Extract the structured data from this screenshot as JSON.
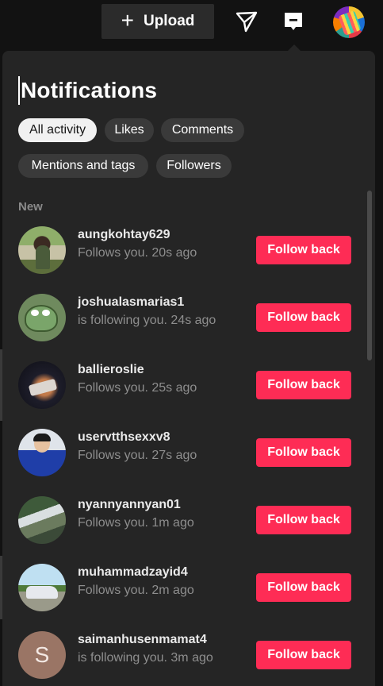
{
  "topbar": {
    "upload_label": "Upload",
    "icons": {
      "plus": "plus-icon",
      "send": "paper-plane-icon",
      "inbox": "inbox-icon",
      "avatar": "profile-avatar"
    }
  },
  "panel": {
    "title": "Notifications",
    "filters": [
      "All activity",
      "Likes",
      "Comments",
      "Mentions and tags",
      "Followers"
    ],
    "active_filter": "All activity",
    "section_label": "New",
    "follow_label": "Follow back",
    "items": [
      {
        "username": "aungkohtay629",
        "sub": "Follows you. 20s ago"
      },
      {
        "username": "joshualasmarias1",
        "sub": "is following you. 24s ago"
      },
      {
        "username": "ballieroslie",
        "sub": "Follows you. 25s ago"
      },
      {
        "username": "uservtthsexxv8",
        "sub": "Follows you. 27s ago"
      },
      {
        "username": "nyannyannyan01",
        "sub": "Follows you. 1m ago"
      },
      {
        "username": "muhammadzayid4",
        "sub": "Follows you. 2m ago"
      },
      {
        "username": "saimanhusenmamat4",
        "sub": "is following you. 3m ago",
        "avatar_letter": "S"
      }
    ]
  },
  "colors": {
    "accent": "#fe2c55",
    "panel_bg": "#252525",
    "chip_bg": "#3a3a3a",
    "chip_active_bg": "#f1f1f1"
  }
}
